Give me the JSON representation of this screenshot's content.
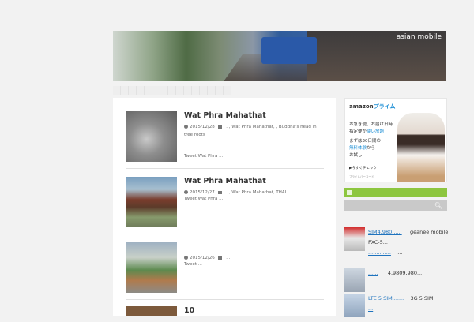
{
  "site": {
    "title": "asian mobile"
  },
  "nav": {
    "item_count": 15
  },
  "posts": [
    {
      "title": "Wat Phra Mahathat",
      "date": "2015/12/28",
      "tags": ".    .    , Wat Phra Mahathat, , Buddha's head in tree roots",
      "excerpt": "Tweet   Wat Phra ..."
    },
    {
      "title": "Wat Phra Mahathat",
      "date": "2015/12/27",
      "tags": ". .    , Wat Phra Mahathat, THAI",
      "excerpt": "Tweet   Wat Phra ..."
    },
    {
      "title": "",
      "date": "2015/12/26",
      "tags": ". . .",
      "excerpt": "Tweet   ..."
    },
    {
      "title": "10",
      "date": "",
      "tags": "",
      "excerpt": ""
    }
  ],
  "sidebar": {
    "ad": {
      "logo": "amazon",
      "logo_accent": "プライム",
      "line1": "お急ぎ便、お届け日時",
      "line2": "指定便が",
      "line2_accent": "使い放題",
      "line3": "まずは30日間の",
      "line4_accent": "無料体験",
      "line4": "から",
      "line5": "お試し",
      "cta": "▶今すぐチェック",
      "small": "プライムバーコード"
    },
    "items": [
      {
        "link": "SIM4,980......",
        "text": "geanee mobile",
        "line2": "FXC-5...",
        "line3_link": "..............",
        "line3": "..."
      },
      {
        "link": "......",
        "text": "4,9809,980...",
        "line2": "",
        "line3_link": "",
        "line3": ""
      },
      {
        "link": "LTE 5 SIM.......",
        "text": "3G 5 SIM",
        "line2": "...",
        "line3_link": "",
        "line3": ""
      }
    ]
  }
}
